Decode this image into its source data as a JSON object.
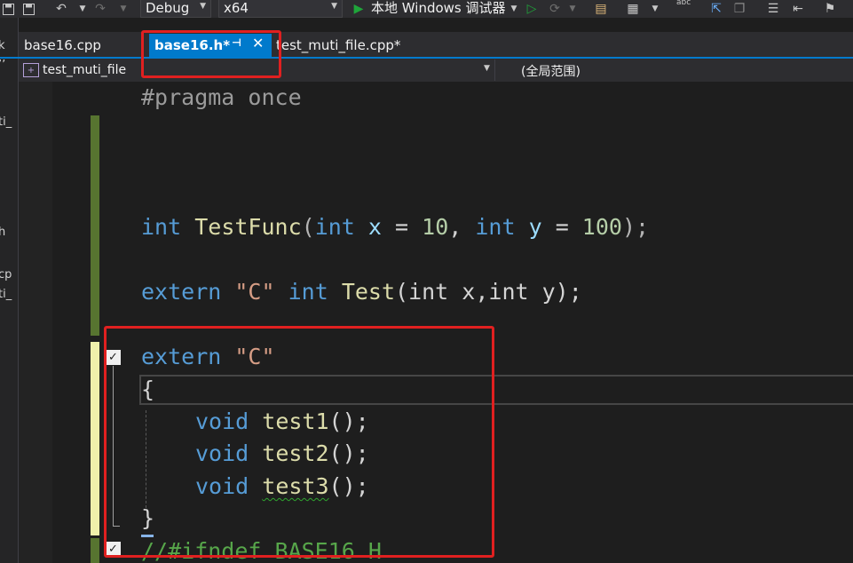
{
  "toolbar": {
    "config": "Debug",
    "platform": "x64",
    "debugger_label": "本地 Windows 调试器",
    "spell_label": "abc"
  },
  "tabs": [
    {
      "label": "base16.cpp"
    },
    {
      "label": "base16.h*",
      "active": true
    },
    {
      "label": "test_muti_file.cpp*"
    }
  ],
  "nav": {
    "project": "test_muti_file",
    "scope": "(全局范围)"
  },
  "left_edge": [
    "k",
    "’’",
    "ti_",
    "h",
    "cp",
    "ti_"
  ],
  "code": {
    "line1": "#pragma once",
    "func_decl": {
      "kw": "int",
      "name": "TestFunc",
      "p1_type": "int",
      "p1": "x",
      "v1": "10",
      "p2_type": "int",
      "p2": "y",
      "v2": "100"
    },
    "extern1": {
      "kw": "extern",
      "str": "\"C\"",
      "type": "int",
      "name": "Test",
      "args": "(int x,int y);"
    },
    "extern2": {
      "kw": "extern",
      "str": "\"C\""
    },
    "open_brace": "{",
    "close_brace": "}",
    "funcs": [
      {
        "type": "void",
        "name": "test1"
      },
      {
        "type": "void",
        "name": "test2"
      },
      {
        "type": "void",
        "name": "test3"
      }
    ],
    "last_line": "//#ifndef BASE16_H"
  },
  "colors": {
    "accent": "#007acc",
    "annotation": "#e02020",
    "keyword": "#569cd6",
    "function": "#dcdcaa"
  }
}
